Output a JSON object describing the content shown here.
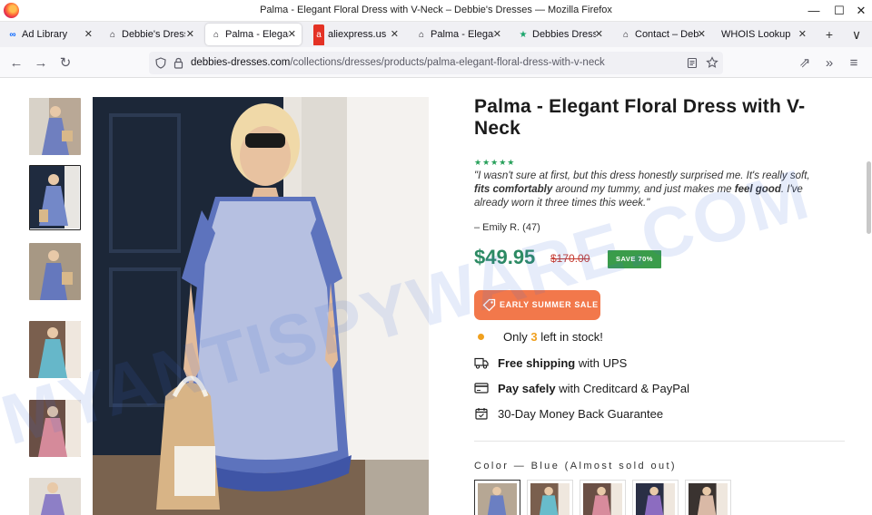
{
  "window": {
    "title": "Palma - Elegant Floral Dress with V-Neck – Debbie's Dresses — Mozilla Firefox",
    "minimize_glyph": "—",
    "maximize_glyph": "☐",
    "close_glyph": "✕"
  },
  "tabs": [
    {
      "label": "Ad Library",
      "icon": "meta-icon",
      "active": false
    },
    {
      "label": "Debbie's Dresses",
      "icon": "bag-icon",
      "active": false
    },
    {
      "label": "Palma - Elegant",
      "icon": "bag-icon",
      "active": true
    },
    {
      "label": "aliexpress.us",
      "icon": "aliexpress-icon",
      "active": false
    },
    {
      "label": "Palma - Elegant",
      "icon": "bag-icon",
      "active": false
    },
    {
      "label": "Debbies Dresses",
      "icon": "star-icon",
      "active": false
    },
    {
      "label": "Contact – Debbie's",
      "icon": "bag-icon",
      "active": false
    },
    {
      "label": "WHOIS Lookup",
      "icon": "none",
      "active": false
    }
  ],
  "tabbar": {
    "new_tab": "+",
    "list_tabs": "∨"
  },
  "navbar": {
    "back": "←",
    "forward": "→",
    "reload": "↻",
    "url_domain": "debbies-dresses.com",
    "url_path": "/collections/dresses/products/palma-elegant-floral-dress-with-v-neck",
    "extensions": "⇗",
    "overflow": "»",
    "menu": "≡"
  },
  "product": {
    "title": "Palma - Elegant Floral Dress with V-Neck",
    "rating_stars": "★★★★★",
    "rating_value": 5,
    "review_part1": "\"I wasn't sure at first, but this dress honestly surprised me. It's really soft, ",
    "review_bold1": "fits comfortably",
    "review_part2": " around my tummy, and just makes me ",
    "review_bold2": "feel good",
    "review_part3": ". I've already worn it three times this week.\"",
    "reviewer": "– Emily R. (47)",
    "price": "$49.95",
    "old_price": "$170.00",
    "save_badge": "SAVE 70%",
    "sale_button": "EARLY SUMMER SALE",
    "stock_pre": "Only ",
    "stock_count": "3",
    "stock_post": " left in stock!",
    "shipping_bold": "Free shipping",
    "shipping_rest": " with UPS",
    "pay_bold": "Pay safely",
    "pay_rest": " with Creditcard & PayPal",
    "guarantee": "30-Day Money Back Guarantee",
    "color_label": "Color — Blue (Almost sold out)"
  },
  "watermark": "MYANTISPYWARE.COM",
  "colors": {
    "price_green": "#2c8a63",
    "old_price_red": "#c5392f",
    "badge_green": "#3a9c4a",
    "sale_orange": "#f2784b",
    "stock_orange": "#f0a01e",
    "stars_green": "#27a05a"
  }
}
